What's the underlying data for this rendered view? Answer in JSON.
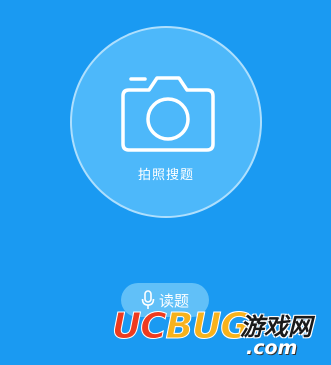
{
  "capture": {
    "label": "拍照搜题",
    "icon": "camera-icon"
  },
  "read_button": {
    "label": "读题",
    "icon": "microphone-icon"
  },
  "watermark": {
    "logo_part1": "UC",
    "logo_part2": "BUG",
    "cn_text": "游戏网",
    "domain": ".com"
  },
  "colors": {
    "background": "#1a9af2",
    "circle": "#4db8fa",
    "button": "#61c0f8",
    "text": "#ffffff"
  }
}
